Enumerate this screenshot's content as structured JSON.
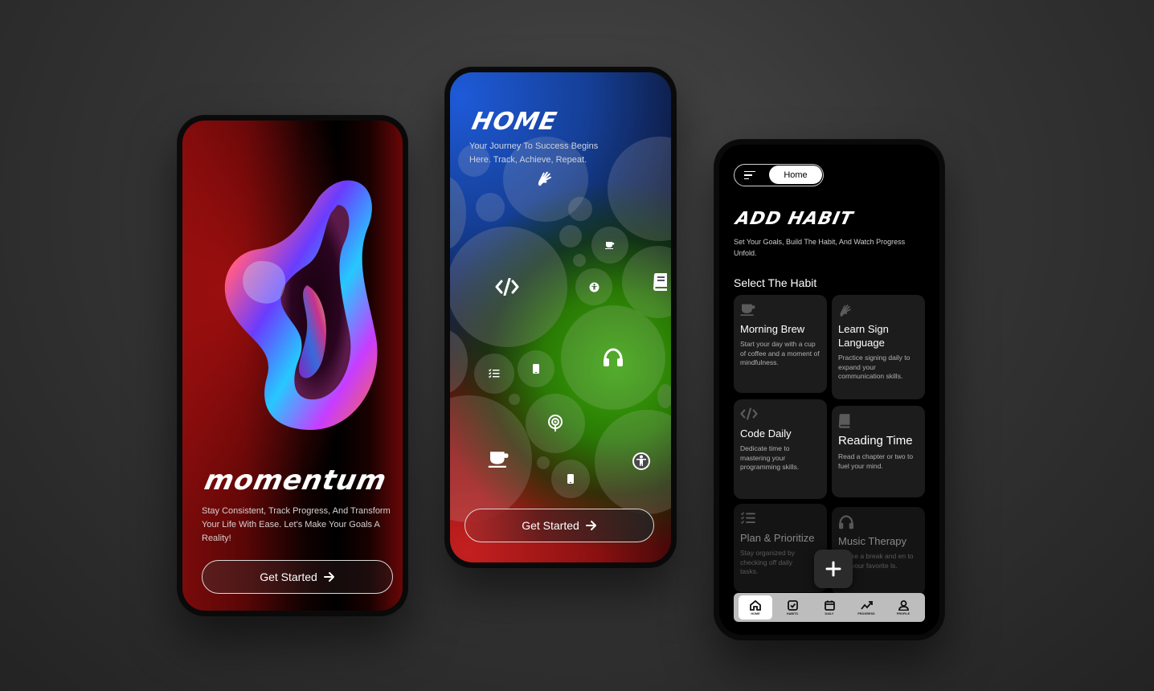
{
  "phone1": {
    "title": "momentum",
    "subtitle": "Stay Consistent, Track Progress, And Transform Your Life With Ease. Let's Make Your Goals A Reality!",
    "button_label": "Get Started"
  },
  "phone2": {
    "title": "HOME",
    "subtitle": "Your Journey To Success Begins Here. Track, Achieve, Repeat.",
    "button_label": "Get Started",
    "bubble_icons": [
      "sign-language-icon",
      "checklist-icon",
      "code-icon",
      "coffee-icon",
      "accessibility-icon",
      "book-icon",
      "headphones-icon",
      "list-icon",
      "phone-icon",
      "podcast-icon"
    ]
  },
  "phone3": {
    "topbar": {
      "home_label": "Home"
    },
    "title": "ADD HABIT",
    "subtitle": "Set Your Goals, Build The Habit, And Watch Progress Unfold.",
    "section_title": "Select The Habit",
    "cards": [
      {
        "title": "Morning Brew",
        "desc": "Start your day with a cup of coffee and a moment of mindfulness.",
        "icon": "coffee-icon"
      },
      {
        "title": "Learn Sign Language",
        "desc": "Practice signing daily to expand your communication skills.",
        "icon": "sign-language-icon"
      },
      {
        "title": "Code Daily",
        "desc": "Dedicate time to mastering your programming skills.",
        "icon": "code-icon"
      },
      {
        "title": "Reading Time",
        "desc": "Read a chapter or two to fuel your mind.",
        "icon": "book-icon"
      },
      {
        "title": "Plan & Prioritize",
        "desc": "Stay organized by checking off daily tasks.",
        "icon": "checklist-icon"
      },
      {
        "title": "Music Therapy",
        "desc": "ke a break and en to your favorite ls.",
        "icon": "headphones-icon"
      }
    ],
    "nav": [
      {
        "label": "HOME",
        "icon": "home-icon"
      },
      {
        "label": "HABITS",
        "icon": "habits-icon"
      },
      {
        "label": "DAILY",
        "icon": "calendar-icon"
      },
      {
        "label": "PROGRESS",
        "icon": "progress-icon"
      },
      {
        "label": "PROFILE",
        "icon": "profile-icon"
      }
    ]
  }
}
